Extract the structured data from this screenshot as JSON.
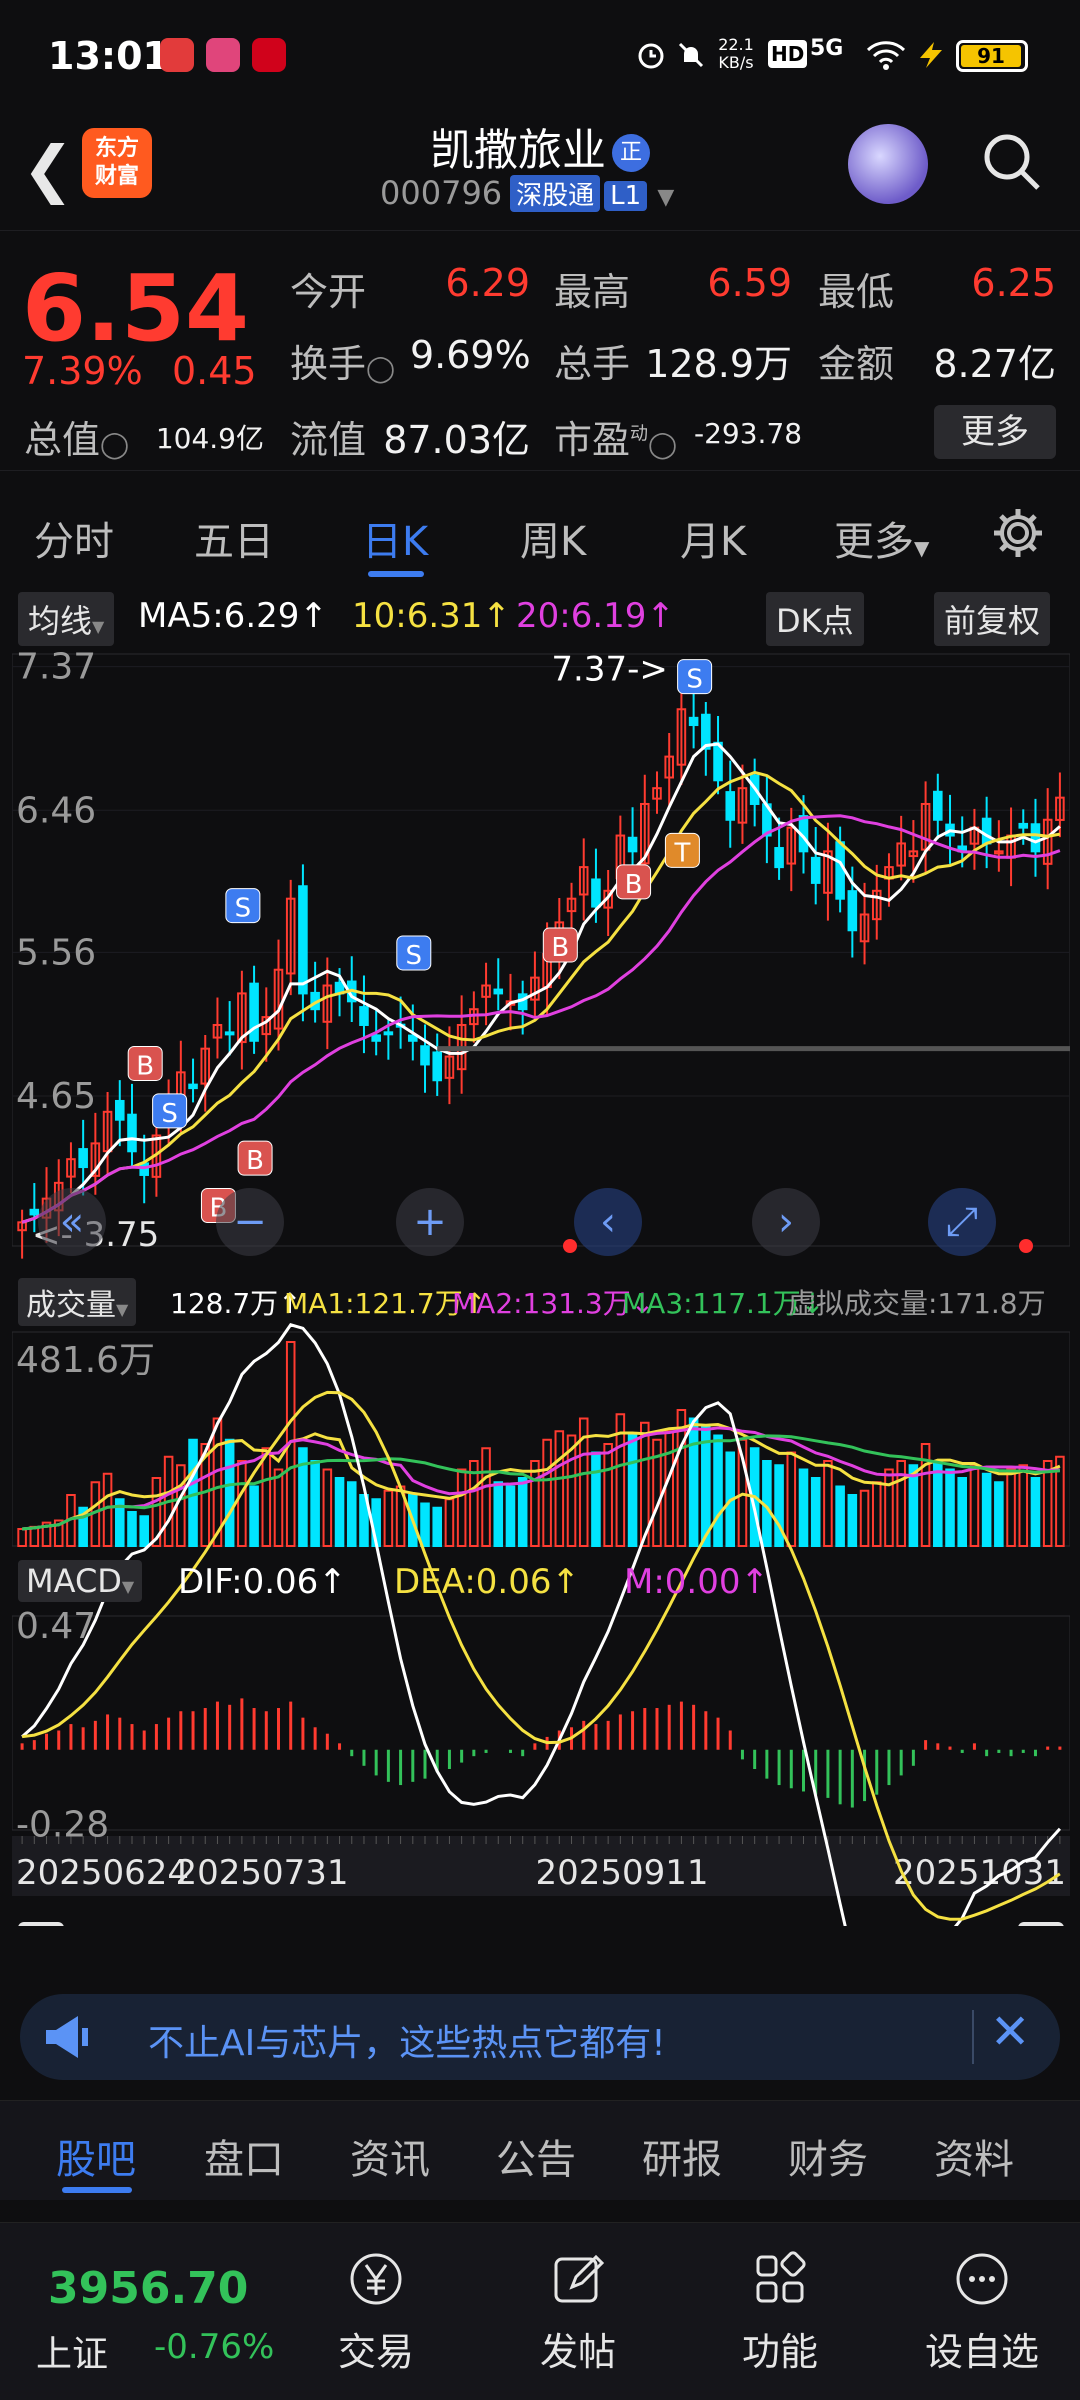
{
  "status": {
    "time": "13:01",
    "net_speed": "22.1",
    "net_unit": "KB/s",
    "network": "5G",
    "battery": "91"
  },
  "header": {
    "logo_line1": "东方",
    "logo_line2": "财富",
    "name": "凯撒旅业",
    "name_badge": "正",
    "code": "000796",
    "exchange": "深股通",
    "level": "L1"
  },
  "quote": {
    "price": "6.54",
    "pct": "7.39%",
    "change": "0.45",
    "open_label": "今开",
    "open": "6.29",
    "high_label": "最高",
    "high": "6.59",
    "low_label": "最低",
    "low": "6.25",
    "turnover_label": "换手",
    "turnover": "9.69%",
    "volume_label": "总手",
    "volume": "128.9万",
    "amount_label": "金额",
    "amount": "8.27亿",
    "mcap_label": "总值",
    "mcap": "104.9亿",
    "float_label": "流值",
    "float": "87.03亿",
    "pe_label": "市盈",
    "pe_sup": "动",
    "pe": "-293.78",
    "more": "更多"
  },
  "tabs": [
    "分时",
    "五日",
    "日K",
    "周K",
    "月K",
    "更多",
    "⚙"
  ],
  "ma_legend": {
    "label": "均线",
    "ma5": "MA5:6.29",
    "ma10": "10:6.31",
    "ma20": "20:6.19",
    "dk": "DK点",
    "fq": "前复权",
    "colors": {
      "ma5": "#ffffff",
      "ma10": "#f5e142",
      "ma20": "#e040e0"
    }
  },
  "vol_legend": {
    "label": "成交量",
    "v": "128.7万",
    "ma1": "MA1:121.7万",
    "ma2": "MA2:131.3万",
    "ma3": "MA3:117.1万",
    "virtual": "虚拟成交量:171.8万"
  },
  "macd_legend": {
    "label": "MACD",
    "dif": "DIF:0.06",
    "dea": "DEA:0.06",
    "m": "M:0.00"
  },
  "chart_data": {
    "type": "line",
    "price_axis": [
      "7.37",
      "6.46",
      "5.56",
      "4.65"
    ],
    "low_label": "3.75",
    "high_label": "7.37->",
    "vol_axis": "481.6万",
    "macd_axis": [
      "0.47",
      "-0.28"
    ],
    "dates": [
      "20250624",
      "20250731",
      "20250911",
      "20251031"
    ],
    "n": 86,
    "closes": [
      3.85,
      3.9,
      4.0,
      4.1,
      4.25,
      4.2,
      4.35,
      4.55,
      4.5,
      4.3,
      4.15,
      4.4,
      4.6,
      4.8,
      4.7,
      4.95,
      5.1,
      5.05,
      5.3,
      5.0,
      5.15,
      5.45,
      5.9,
      5.3,
      5.2,
      5.35,
      5.3,
      5.25,
      5.1,
      5.0,
      5.05,
      5.1,
      5.0,
      4.85,
      4.75,
      4.9,
      5.1,
      5.2,
      5.35,
      5.3,
      5.25,
      5.2,
      5.4,
      5.55,
      5.75,
      5.9,
      6.1,
      5.85,
      5.95,
      6.3,
      6.2,
      6.5,
      6.6,
      6.8,
      7.1,
      7.0,
      6.85,
      6.65,
      6.4,
      6.6,
      6.5,
      6.3,
      6.1,
      6.35,
      6.2,
      6.0,
      6.2,
      5.9,
      5.7,
      5.8,
      5.95,
      6.1,
      6.25,
      6.2,
      6.5,
      6.4,
      6.3,
      6.2,
      6.35,
      6.25,
      6.2,
      6.3,
      6.35,
      6.2,
      6.4,
      6.54
    ],
    "volumes": [
      40,
      45,
      55,
      60,
      120,
      90,
      150,
      170,
      110,
      80,
      70,
      160,
      210,
      190,
      250,
      240,
      300,
      250,
      200,
      140,
      230,
      180,
      480,
      230,
      200,
      180,
      160,
      150,
      120,
      110,
      130,
      140,
      120,
      100,
      90,
      110,
      180,
      200,
      230,
      150,
      140,
      160,
      200,
      250,
      270,
      260,
      300,
      220,
      240,
      310,
      260,
      290,
      250,
      270,
      320,
      300,
      280,
      260,
      220,
      250,
      230,
      200,
      190,
      220,
      180,
      160,
      200,
      140,
      120,
      130,
      150,
      180,
      200,
      190,
      240,
      200,
      180,
      160,
      190,
      170,
      150,
      180,
      190,
      160,
      200,
      210
    ],
    "macd_hist": [
      0.02,
      0.03,
      0.05,
      0.06,
      0.08,
      0.07,
      0.09,
      0.11,
      0.1,
      0.08,
      0.06,
      0.08,
      0.1,
      0.12,
      0.12,
      0.13,
      0.15,
      0.14,
      0.16,
      0.13,
      0.12,
      0.13,
      0.15,
      0.1,
      0.07,
      0.05,
      0.02,
      -0.02,
      -0.05,
      -0.08,
      -0.1,
      -0.11,
      -0.1,
      -0.09,
      -0.07,
      -0.06,
      -0.04,
      -0.02,
      -0.01,
      0.0,
      -0.01,
      -0.02,
      0.02,
      0.04,
      0.06,
      0.07,
      0.09,
      0.08,
      0.09,
      0.11,
      0.12,
      0.13,
      0.13,
      0.14,
      0.15,
      0.14,
      0.12,
      0.1,
      0.06,
      -0.03,
      -0.06,
      -0.09,
      -0.11,
      -0.12,
      -0.13,
      -0.14,
      -0.15,
      -0.17,
      -0.18,
      -0.16,
      -0.14,
      -0.11,
      -0.08,
      -0.05,
      0.03,
      0.02,
      0.01,
      -0.01,
      0.02,
      -0.02,
      -0.01,
      -0.02,
      -0.01,
      -0.02,
      0.01,
      0.01
    ]
  },
  "banner": {
    "text": "不止AI与芯片，这些热点它都有!"
  },
  "bottom_tabs": [
    "股吧",
    "盘口",
    "资讯",
    "公告",
    "研报",
    "财务",
    "资料"
  ],
  "footer": {
    "index_value": "3956.70",
    "index_name": "上证",
    "index_pct": "-0.76%",
    "items": [
      "交易",
      "发帖",
      "功能",
      "设自选"
    ]
  }
}
